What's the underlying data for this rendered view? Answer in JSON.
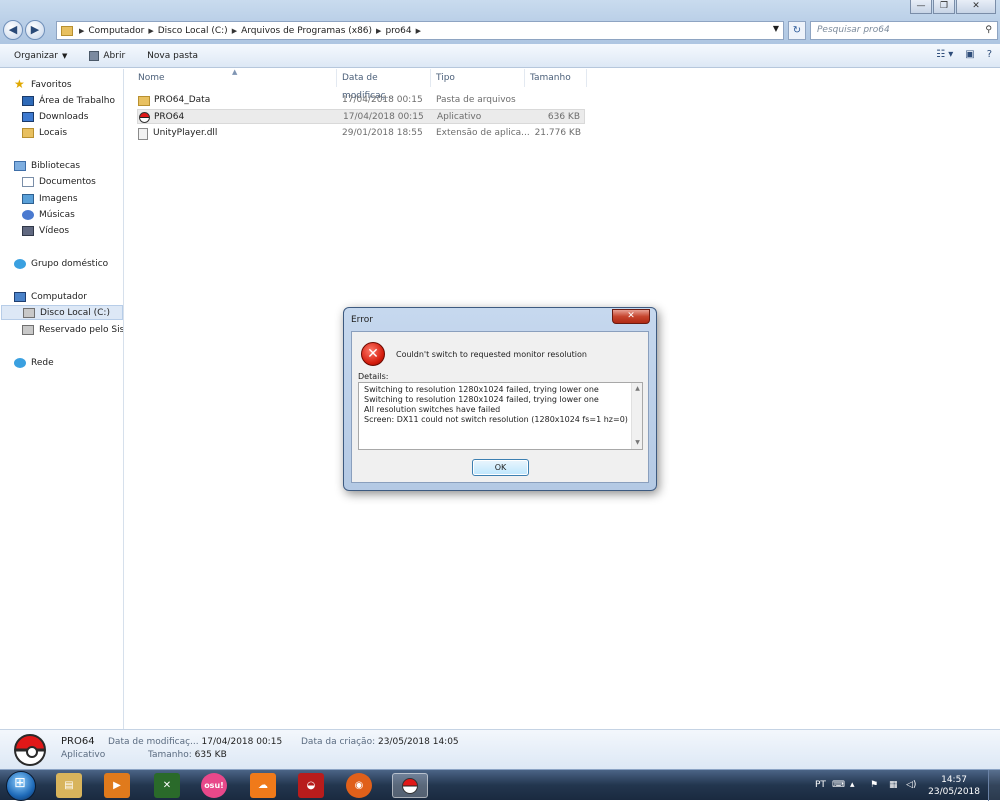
{
  "window": {
    "controls": {
      "minimize": "—",
      "maximize": "❐",
      "close": "✕"
    },
    "nav": {
      "back": "◀",
      "forward": "▶"
    },
    "address": {
      "crumbs": [
        "Computador",
        "Disco Local (C:)",
        "Arquivos de Programas (x86)",
        "pro64"
      ]
    },
    "search_placeholder": "Pesquisar pro64"
  },
  "toolbar": {
    "organize": "Organizar",
    "open": "Abrir",
    "new_folder": "Nova pasta"
  },
  "nav_pane": {
    "favorites": "Favoritos",
    "desktop": "Área de Trabalho",
    "downloads": "Downloads",
    "places": "Locais",
    "libraries": "Bibliotecas",
    "documents": "Documentos",
    "images": "Imagens",
    "music": "Músicas",
    "videos": "Vídeos",
    "homegroup": "Grupo doméstico",
    "computer": "Computador",
    "local_disk": "Disco Local (C:)",
    "reserved": "Reservado pelo Sistema",
    "network": "Rede"
  },
  "file_list": {
    "columns": {
      "name": "Nome",
      "date": "Data de modificaç...",
      "type": "Tipo",
      "size": "Tamanho"
    },
    "rows": [
      {
        "name": "PRO64_Data",
        "date": "17/04/2018 00:15",
        "type": "Pasta de arquivos",
        "size": ""
      },
      {
        "name": "PRO64",
        "date": "17/04/2018 00:15",
        "type": "Aplicativo",
        "size": "636 KB"
      },
      {
        "name": "UnityPlayer.dll",
        "date": "29/01/2018 18:55",
        "type": "Extensão de aplica...",
        "size": "21.776 KB"
      }
    ]
  },
  "details_pane": {
    "name": "PRO64",
    "type": "Aplicativo",
    "modified_label": "Data de modificaç...",
    "modified_value": "17/04/2018 00:15",
    "size_label": "Tamanho:",
    "size_value": "635 KB",
    "created_label": "Data da criação:",
    "created_value": "23/05/2018 14:05"
  },
  "dialog": {
    "title": "Error",
    "close": "✕",
    "message": "Couldn't switch to requested monitor resolution",
    "details_label": "Details:",
    "details_lines": [
      "Switching to resolution 1280x1024 failed, trying lower one",
      "Switching to resolution 1280x1024 failed, trying lower one",
      "All resolution switches have failed",
      "Screen: DX11 could not switch resolution (1280x1024 fs=1 hz=0)"
    ],
    "ok": "OK"
  },
  "taskbar": {
    "osu_label": "osu!",
    "language": "PT",
    "time": "14:57",
    "date": "23/05/2018"
  }
}
